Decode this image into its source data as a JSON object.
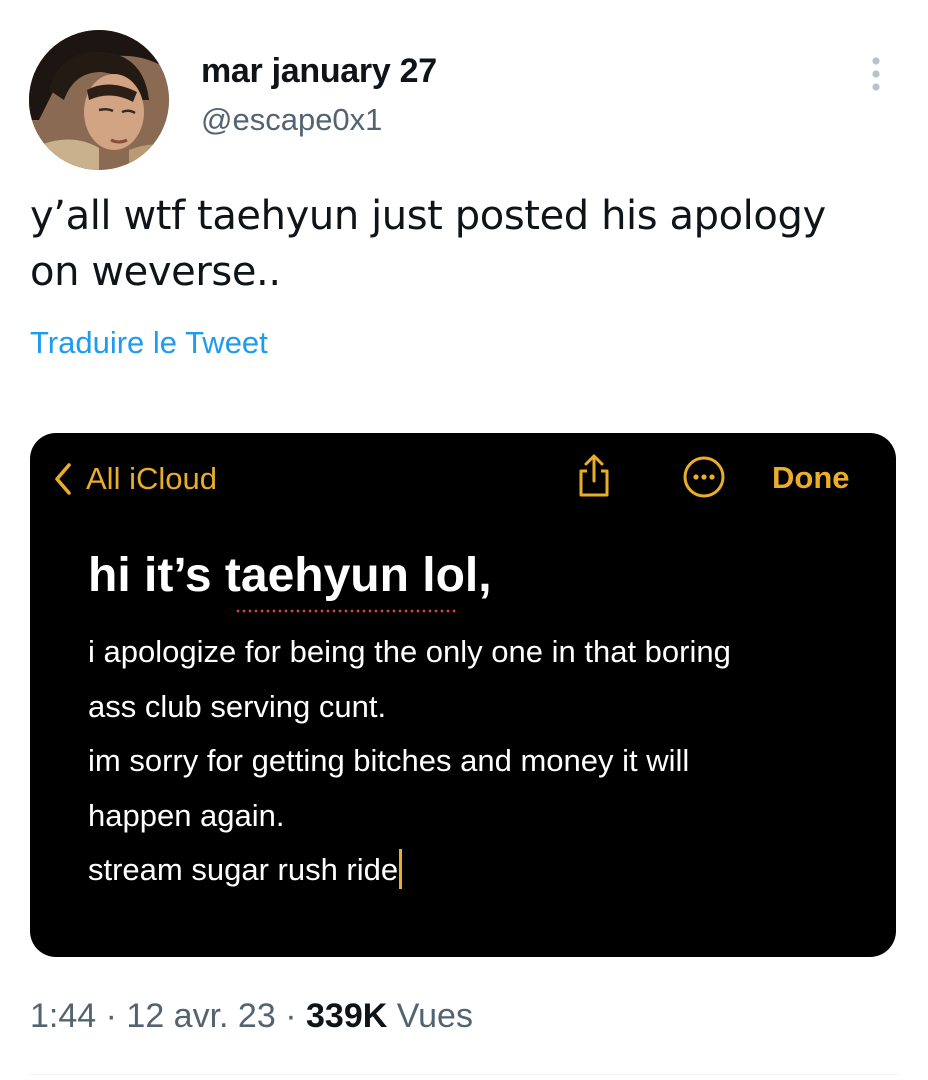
{
  "author": {
    "display_name": "mar january 27",
    "handle": "@escape0x1",
    "avatar_icon": "profile-photo"
  },
  "tweet": {
    "text_line1": "y’all wtf taehyun just posted his apology",
    "text_line2": "on weverse..",
    "translate_label": "Traduire le Tweet"
  },
  "media": {
    "app": "notes",
    "back_label": "All iCloud",
    "done_label": "Done",
    "accent_color": "#e9ad2a",
    "title": "hi it’s taehyun lol,",
    "lines": [
      "i apologize for being the only one in that boring",
      "ass club serving cunt.",
      "im sorry for getting bitches and money it will",
      "happen again.",
      "stream sugar rush ride"
    ]
  },
  "meta": {
    "time": "1:44",
    "separator": "·",
    "date": "12 avr. 23",
    "views_count": "339K",
    "views_label": "Vues"
  },
  "colors": {
    "text_primary": "#0f1419",
    "text_secondary": "#536471",
    "link": "#1d9bf0"
  }
}
